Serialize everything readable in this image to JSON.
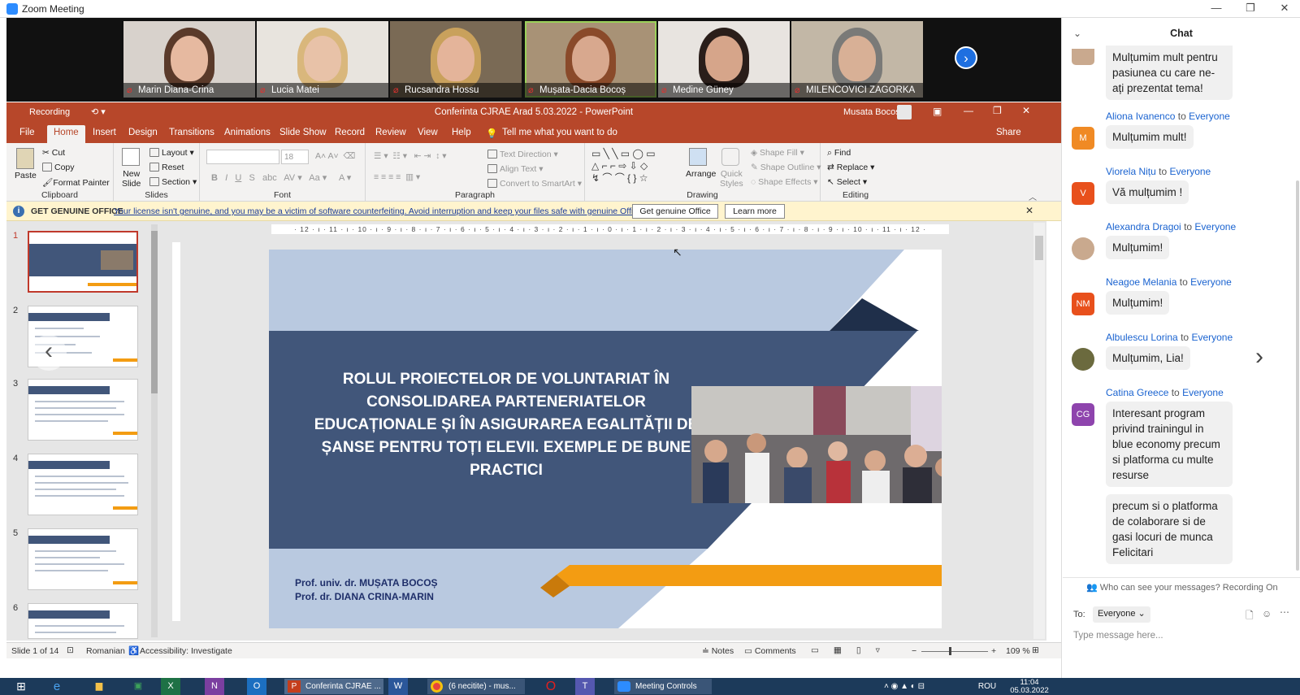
{
  "zoom_window": {
    "title": "Zoom Meeting"
  },
  "participants": [
    {
      "name": "Marin Diana-Crina",
      "muted": true,
      "hair": "#5a3a2a",
      "bg": "#d8d2cc",
      "face": "#e6b9a0"
    },
    {
      "name": "Lucia Matei",
      "muted": true,
      "hair": "#d9b77c",
      "bg": "#e8e4de",
      "face": "#e8c2a8"
    },
    {
      "name": "Rucsandra Hossu",
      "muted": true,
      "hair": "#c9a15c",
      "bg": "#7a6a55",
      "face": "#e4b49a"
    },
    {
      "name": "Mușata-Dacia Bocoș",
      "muted": true,
      "active": true,
      "hair": "#8a4a2a",
      "bg": "#a89276",
      "face": "#d8a88e"
    },
    {
      "name": "Medine Güney",
      "muted": true,
      "hair": "#2a1e1a",
      "bg": "#e8e4e0",
      "face": "#d6a58a"
    },
    {
      "name": "MILENCOVICI ZAGORKA",
      "muted": true,
      "hair": "#7a7a78",
      "bg": "#c2b7a6",
      "face": "#d8b096"
    }
  ],
  "powerpoint": {
    "title": "Conferinta CJRAE Arad 5.03.2022  -  PowerPoint",
    "user": "Musata Bocos",
    "recording_label": "Recording",
    "share_label": "Share",
    "tabs": [
      "File",
      "Home",
      "Insert",
      "Design",
      "Transitions",
      "Animations",
      "Slide Show",
      "Record",
      "Review",
      "View",
      "Help"
    ],
    "tell_me": "Tell me what you want to do",
    "ribbon": {
      "clipboard": {
        "label": "Clipboard",
        "paste": "Paste",
        "cut": "Cut",
        "copy": "Copy",
        "format_painter": "Format Painter"
      },
      "slides": {
        "label": "Slides",
        "new_slide": "New\nSlide",
        "layout": "Layout",
        "reset": "Reset",
        "section": "Section"
      },
      "font": {
        "label": "Font",
        "size": "18"
      },
      "paragraph": {
        "label": "Paragraph",
        "text_direction": "Text Direction",
        "align_text": "Align Text",
        "convert": "Convert to SmartArt"
      },
      "drawing": {
        "label": "Drawing",
        "arrange": "Arrange",
        "quick_styles": "Quick\nStyles",
        "shape_fill": "Shape Fill",
        "shape_outline": "Shape Outline",
        "shape_effects": "Shape Effects"
      },
      "editing": {
        "label": "Editing",
        "find": "Find",
        "replace": "Replace",
        "select": "Select"
      }
    },
    "message_bar": {
      "heading": "GET GENUINE OFFICE",
      "text": "Your license isn't genuine, and you may be a victim of software counterfeiting. Avoid interruption and keep your files safe with genuine Office today.",
      "btn_genuine": "Get genuine Office",
      "btn_learn": "Learn more"
    },
    "ruler_text": "· 12 · ı · 11 · ı · 10 · ı · 9 · ı · 8 · ı · 7 · ı · 6 · ı · 5 · ı · 4 · ı · 3 · ı · 2 · ı · 1 · ı · 0 · ı · 1 · ı · 2 · ı · 3 · ı · 4 · ı · 5 · ı · 6 · ı · 7 · ı · 8 · ı · 9 · ı · 10 · ı · 11 · ı · 12 ·",
    "slide_numbers": [
      "1",
      "2",
      "3",
      "4",
      "5",
      "6"
    ],
    "slide": {
      "title": "ROLUL PROIECTELOR DE VOLUNTARIAT ÎN CONSOLIDAREA PARTENERIATELOR EDUCAȚIONALE ȘI ÎN ASIGURAREA EGALITĂȚII DE ȘANSE PENTRU TOȚI ELEVII. EXEMPLE DE BUNE PRACTICI",
      "author1": "Prof. univ. dr. MUȘATA BOCOȘ",
      "author2": "Prof. dr. DIANA CRINA-MARIN"
    },
    "status": {
      "slide": "Slide 1 of 14",
      "language": "Romanian",
      "accessibility": "Accessibility: Investigate",
      "notes": "Notes",
      "comments": "Comments",
      "zoom": "109 %"
    }
  },
  "chat": {
    "title": "Chat",
    "first_message": "Mulțumim mult pentru pasiunea cu care ne-ați prezentat tema!",
    "to_word": "to",
    "messages": [
      {
        "from": "Aliona Ivanenco",
        "to": "Everyone",
        "text": "Mulțumim mult!",
        "avatar_text": "M",
        "avatar_color": "#f08a24"
      },
      {
        "from": "Viorela Nițu",
        "to": "Everyone",
        "text": "Vă mulțumim !",
        "avatar_text": "V",
        "avatar_color": "#e8501c"
      },
      {
        "from": "Alexandra Dragoi",
        "to": "Everyone",
        "text": "Mulțumim!",
        "avatar_text": "",
        "avatar_color": "#c9a98e"
      },
      {
        "from": "Neagoe Melania",
        "to": "Everyone",
        "text": "Mulțumim!",
        "avatar_text": "NM",
        "avatar_color": "#e8501c"
      },
      {
        "from": "Albulescu Lorina",
        "to": "Everyone",
        "text": "Mulțumim, Lia!",
        "avatar_text": "",
        "avatar_color": "#6b6a3e"
      },
      {
        "from": "Catina  Greece",
        "to": "Everyone",
        "text": "Interesant program privind trainingul in blue economy precum si platforma cu multe resurse",
        "avatar_text": "CG",
        "avatar_color": "#8e44ad"
      }
    ],
    "followup": "precum si o platforma de colaborare si de gasi locuri de munca Felicitari",
    "privacy_note": "Who can see your messages? Recording On",
    "to_label": "To:",
    "to_value": "Everyone",
    "input_placeholder": "Type message here..."
  },
  "taskbar": {
    "items": [
      "Conferinta CJRAE ...",
      "(6 necitite) - mus...",
      "Meeting Controls"
    ],
    "lang": "ROU",
    "time": "11:04",
    "date": "05.03.2022"
  }
}
